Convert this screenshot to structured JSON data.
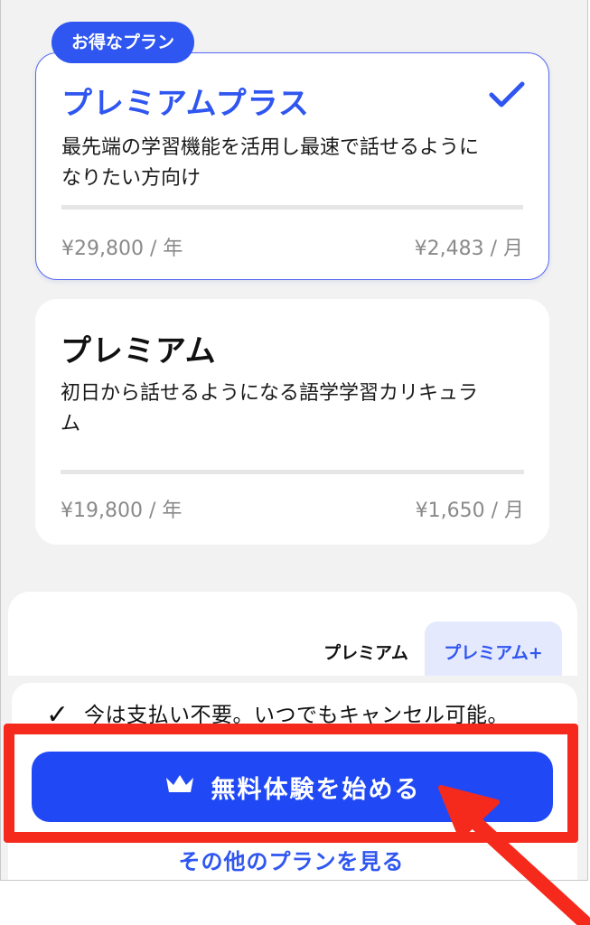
{
  "badge": "お得なプラン",
  "plans": [
    {
      "title": "プレミアムプラス",
      "description": "最先端の学習機能を活用し最速で話せるようになりたい方向け",
      "price_year": "¥29,800 / 年",
      "price_month": "¥2,483 / 月",
      "selected": true
    },
    {
      "title": "プレミアム",
      "description": "初日から話せるようになる語学学習カリキュラム",
      "price_year": "¥19,800 / 年",
      "price_month": "¥1,650 / 月",
      "selected": false
    }
  ],
  "tabs": [
    {
      "label": "プレミアム",
      "active": false
    },
    {
      "label": "プレミアム+",
      "active": true
    }
  ],
  "note": "今は支払い不要。いつでもキャンセル可能。",
  "cta_label": "無料体験を始める",
  "other_plans_link": "その他のプランを見る",
  "colors": {
    "accent": "#2F56F0",
    "cta": "#2049F5",
    "annotation": "#F52A1C"
  },
  "icons": {
    "selected_check": "check-icon",
    "cta": "crown-icon",
    "note": "checkmark-icon",
    "annotation": "arrow-icon"
  }
}
